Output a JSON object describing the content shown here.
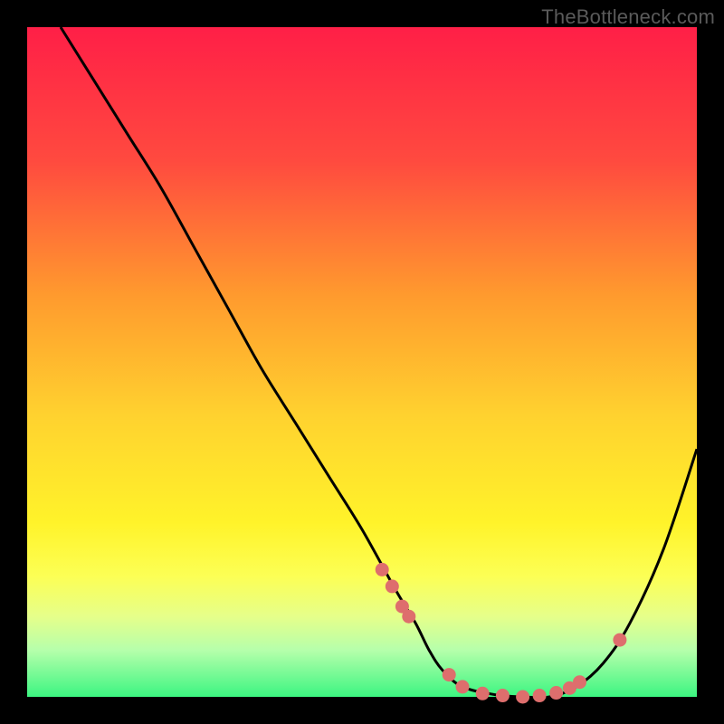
{
  "watermark": "TheBottleneck.com",
  "colors": {
    "background": "#000000",
    "curve": "#000000",
    "marker": "#de6e6d",
    "gradient_stops": [
      {
        "offset": "0%",
        "color": "#ff1f47"
      },
      {
        "offset": "20%",
        "color": "#ff4a3f"
      },
      {
        "offset": "40%",
        "color": "#ff9a2e"
      },
      {
        "offset": "58%",
        "color": "#ffd22f"
      },
      {
        "offset": "74%",
        "color": "#fff32a"
      },
      {
        "offset": "82%",
        "color": "#fcff55"
      },
      {
        "offset": "88%",
        "color": "#e6ff8a"
      },
      {
        "offset": "93%",
        "color": "#b6ffab"
      },
      {
        "offset": "100%",
        "color": "#3cf581"
      }
    ]
  },
  "chart_data": {
    "type": "line",
    "title": "",
    "xlabel": "",
    "ylabel": "",
    "xlim": [
      0,
      100
    ],
    "ylim": [
      0,
      100
    ],
    "series": [
      {
        "name": "curve",
        "x": [
          5,
          10,
          15,
          20,
          25,
          30,
          35,
          40,
          45,
          50,
          55,
          58,
          60,
          62,
          65,
          70,
          74,
          78,
          82,
          86,
          90,
          95,
          100
        ],
        "y": [
          100,
          92,
          84,
          76,
          67,
          58,
          49,
          41,
          33,
          25,
          16,
          11,
          7,
          4,
          1.5,
          0.3,
          0,
          0,
          1.5,
          5,
          11,
          22,
          37
        ]
      }
    ],
    "markers": {
      "name": "highlighted-points",
      "x": [
        53,
        54.5,
        56,
        57,
        63,
        65,
        68,
        71,
        74,
        76.5,
        79,
        81,
        82.5,
        88.5
      ],
      "y": [
        19,
        16.5,
        13.5,
        12,
        3.3,
        1.5,
        0.5,
        0.2,
        0,
        0.2,
        0.6,
        1.3,
        2.2,
        8.5
      ]
    }
  }
}
